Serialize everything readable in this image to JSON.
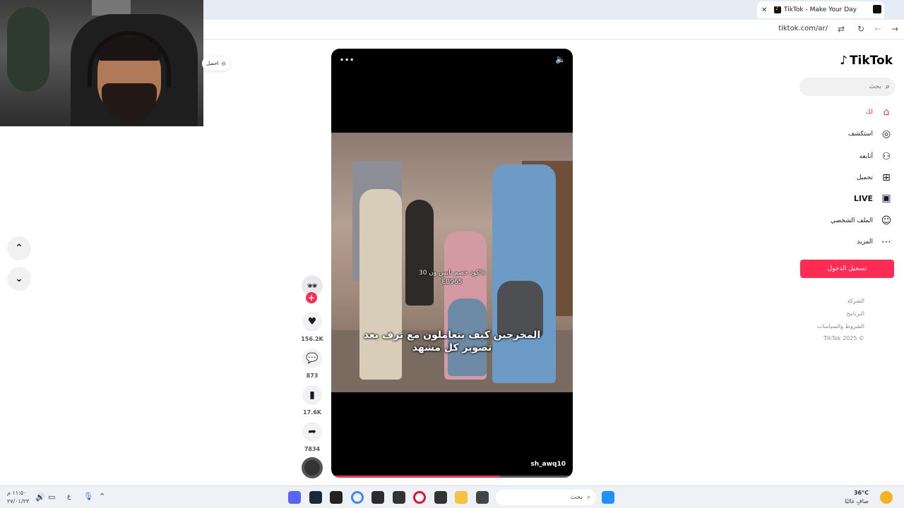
{
  "browser": {
    "tab_title": "TikTok - Make Your Day",
    "tab_close": "✕",
    "new_tab": "+",
    "url": "tiktok.com/ar/"
  },
  "left_chip": {
    "label": "احصل"
  },
  "nav": {
    "up": "⌃",
    "down": "⌄"
  },
  "video": {
    "promo_line1": "كود خصم نايس ون 30%",
    "promo_line2": "EB965",
    "caption_line1": "المخرجين كيف يتعاملون مع ترف بعد",
    "caption_line2": "تصوير كل مشهد",
    "author": "sh_awq10",
    "progress": 0.7
  },
  "actions": {
    "likes": "156.2K",
    "comments": "873",
    "saves": "17.6K",
    "shares": "7834"
  },
  "sidebar": {
    "logo": "TikTok",
    "search_placeholder": "بحث",
    "items": [
      {
        "label": "لك",
        "icon": "home-icon"
      },
      {
        "label": "استكشف",
        "icon": "compass-icon"
      },
      {
        "label": "أتابعه",
        "icon": "following-icon"
      },
      {
        "label": "تحميل",
        "icon": "upload-icon"
      },
      {
        "label": "LIVE",
        "icon": "live-icon"
      },
      {
        "label": "الملف الشخصي",
        "icon": "profile-icon"
      },
      {
        "label": "المزيد",
        "icon": "more-icon"
      }
    ],
    "login": "تسجيل الدخول",
    "footer": [
      "الشركة",
      "البرنامج",
      "الشروط والسياسات",
      "© TikTok 2025"
    ]
  },
  "taskbar": {
    "search_placeholder": "بحث",
    "time": "١١:٥٠ م",
    "date": "٢٧/٠١/٢٣",
    "lang": "ع",
    "weather_temp": "36°C",
    "weather_desc": "صافٍ غالبًا"
  },
  "colors": {
    "accent": "#fe2c55"
  }
}
